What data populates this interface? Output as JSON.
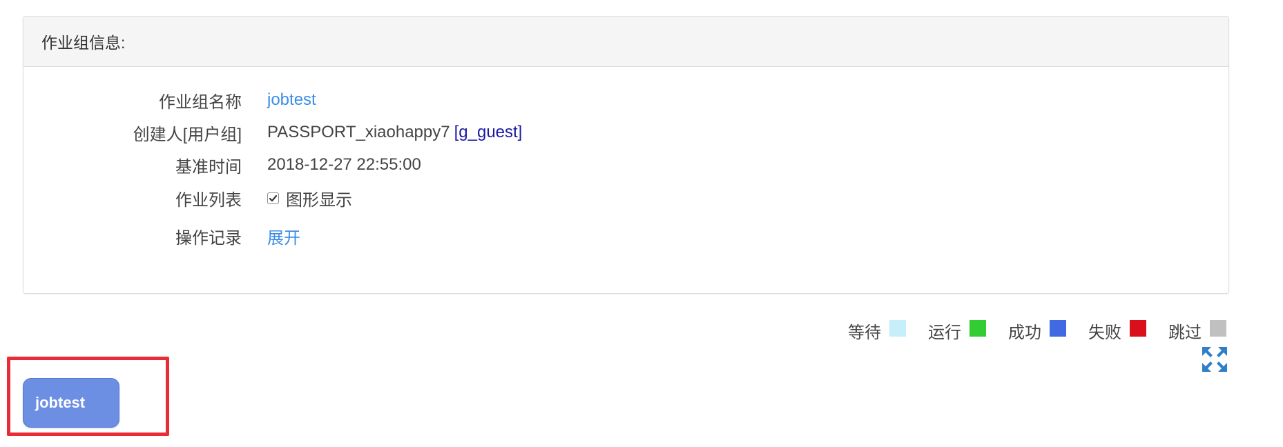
{
  "panel": {
    "title": "作业组信息:"
  },
  "info": {
    "name_label": "作业组名称",
    "name_value": "jobtest",
    "creator_label": "创建人[用户组]",
    "creator_value": "PASSPORT_xiaohappy7",
    "creator_group": "[g_guest]",
    "basetime_label": "基准时间",
    "basetime_value": "2018-12-27 22:55:00",
    "joblist_label": "作业列表",
    "joblist_checkbox_label": "图形显示",
    "joblist_checkbox_checked": true,
    "oplog_label": "操作记录",
    "oplog_link": "展开"
  },
  "legend": {
    "items": [
      {
        "label": "等待",
        "color": "#c6eefb"
      },
      {
        "label": "运行",
        "color": "#33cc33"
      },
      {
        "label": "成功",
        "color": "#4169e1"
      },
      {
        "label": "失败",
        "color": "#d9101b"
      },
      {
        "label": "跳过",
        "color": "#c0c0c0"
      }
    ]
  },
  "toolbar": {
    "fullscreen_icon": "expand-arrows-icon",
    "fullscreen_color": "#2f80c8"
  },
  "graph": {
    "node_label": "jobtest",
    "node_color": "#6c8ee3",
    "highlight_color": "#ea2b35"
  }
}
